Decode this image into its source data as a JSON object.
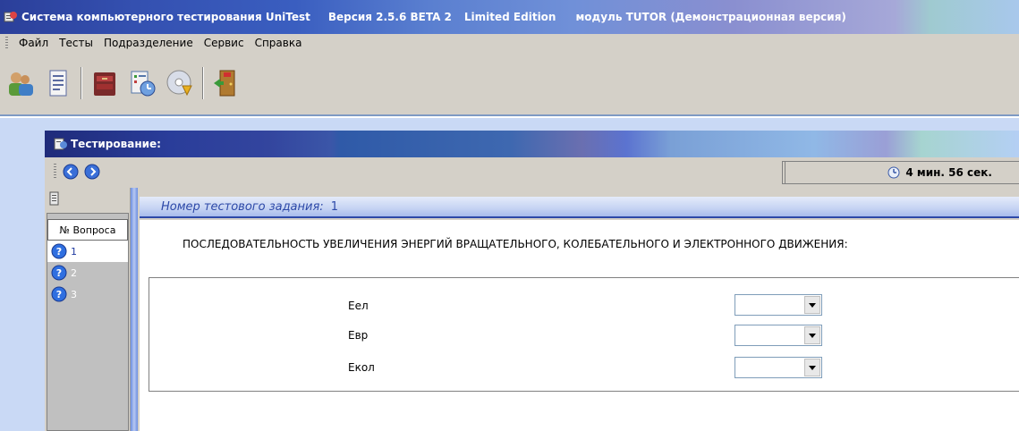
{
  "window": {
    "title_main": "Система компьютерного тестирования UniTest",
    "title_version": "Версия 2.5.6 BETA 2",
    "title_edition": "Limited Edition",
    "title_module": "модуль TUTOR  (Демонстрационная версия)"
  },
  "menu": {
    "items": [
      {
        "label": "Файл"
      },
      {
        "label": "Тесты"
      },
      {
        "label": "Подразделение"
      },
      {
        "label": "Сервис"
      },
      {
        "label": "Справка"
      }
    ]
  },
  "toolbar": {
    "icons": [
      "users-icon",
      "document-icon",
      "archive-icon",
      "schedule-icon",
      "cd-install-icon",
      "exit-door-icon"
    ]
  },
  "testing": {
    "title": "Тестирование:",
    "timer": "4 мин.  56 сек."
  },
  "questions": {
    "header": "№ Вопроса",
    "items": [
      {
        "num": "1",
        "selected": true
      },
      {
        "num": "2",
        "selected": false
      },
      {
        "num": "3",
        "selected": false
      }
    ]
  },
  "task": {
    "label": "Номер тестового задания:",
    "number": "1",
    "question": "ПОСЛЕДОВАТЕЛЬНОСТЬ УВЕЛИЧЕНИЯ ЭНЕРГИЙ ВРАЩАТЕЛЬНОГО, КОЛЕБАТЕЛЬНОГО И ЭЛЕКТРОННОГО ДВИЖЕНИЯ:",
    "rows": [
      {
        "label": "Еел",
        "value": ""
      },
      {
        "label": "Евр",
        "value": ""
      },
      {
        "label": "Екол",
        "value": ""
      }
    ]
  }
}
